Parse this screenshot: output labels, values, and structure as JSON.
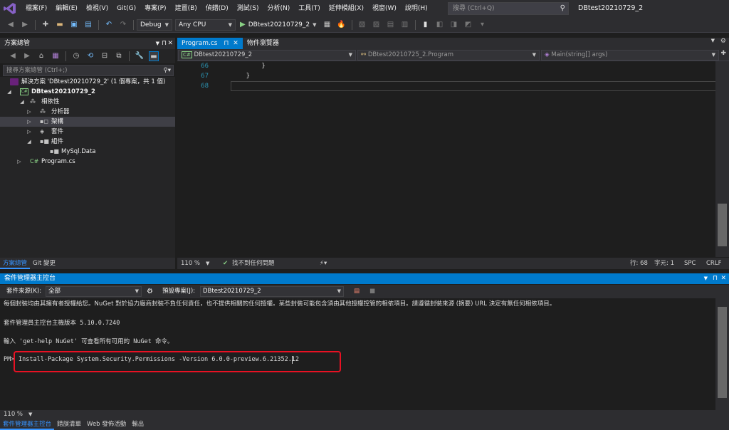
{
  "menubar": {
    "items": [
      "檔案(F)",
      "編輯(E)",
      "檢視(V)",
      "Git(G)",
      "專案(P)",
      "建置(B)",
      "偵錯(D)",
      "測試(S)",
      "分析(N)",
      "工具(T)",
      "延伸模組(X)",
      "視窗(W)",
      "說明(H)"
    ],
    "search_placeholder": "搜尋 (Ctrl+Q)",
    "solution_title": "DBtest20210729_2"
  },
  "toolbar": {
    "config": "Debug",
    "platform": "Any CPU",
    "start_label": "DBtest20210729_2"
  },
  "solution_explorer": {
    "title": "方案總管",
    "search_placeholder": "搜尋方案總管 (Ctrl+;)",
    "tree": {
      "solution": "解決方案 'DBtest20210729_2' (1 個專案，共 1 個)",
      "project": "DBtest20210729_2",
      "dependencies": "相依性",
      "analyzers": "分析器",
      "frameworks": "架構",
      "packages": "套件",
      "assemblies": "組件",
      "mysql": "MySql.Data",
      "program": "Program.cs"
    },
    "tabs": [
      "方案總管",
      "Git 變更"
    ]
  },
  "editor": {
    "tabs": [
      "Program.cs",
      "物件瀏覽器"
    ],
    "nav": {
      "project": "DBtest20210729_2",
      "class": "DBtest20210725_2.Program",
      "member": "Main(string[] args)"
    },
    "lines": [
      {
        "num": "66",
        "code": "        }"
      },
      {
        "num": "67",
        "code": "    }"
      },
      {
        "num": "68",
        "code": ""
      }
    ],
    "status": {
      "zoom": "110 %",
      "issues": "找不到任何問題",
      "line": "行: 68",
      "char": "字元: 1",
      "spc": "SPC",
      "crlf": "CRLF"
    }
  },
  "pmc": {
    "title": "套件管理器主控台",
    "source_label": "套件來源(K):",
    "source_value": "全部",
    "project_label": "預設專案(J):",
    "project_value": "DBtest20210729_2",
    "output": [
      "每個封裝均由其擁有者授權給您。NuGet 對於協力廠商封裝不負任何責任，也不提供相關的任何授權。某些封裝可能包含須由其他授權控管的相依項目。請遵循封裝來源 (摘要) URL 決定有無任何相依項目。",
      "套件管理員主控台主機版本 5.10.0.7240",
      "輸入 'get-help NuGet' 可查看所有可用的 NuGet 命令。",
      "PM>",
      "Install-Package System.Security.Permissions -Version 6.0.0-preview.6.21352.12"
    ],
    "zoom": "110 %",
    "tabs": [
      "套件管理器主控台",
      "錯誤清單",
      "Web 發佈活動",
      "輸出"
    ]
  },
  "colors": {
    "accent": "#007acc",
    "highlight": "#e81123"
  }
}
